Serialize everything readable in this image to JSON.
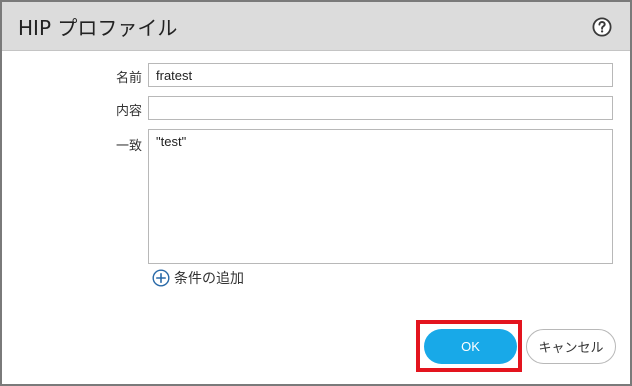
{
  "dialog": {
    "title": "HIP プロファイル",
    "help_icon": "help-icon"
  },
  "form": {
    "name": {
      "label": "名前",
      "value": "fratest"
    },
    "description": {
      "label": "内容",
      "value": ""
    },
    "match": {
      "label": "一致",
      "value": "\"test\""
    },
    "add_condition": {
      "label": "条件の追加",
      "icon": "plus-circle-icon"
    }
  },
  "buttons": {
    "ok": "OK",
    "cancel": "キャンセル"
  },
  "colors": {
    "ok_button": "#18a9e8",
    "highlight_box": "#e3141e",
    "titlebar": "#dcdcdc"
  }
}
